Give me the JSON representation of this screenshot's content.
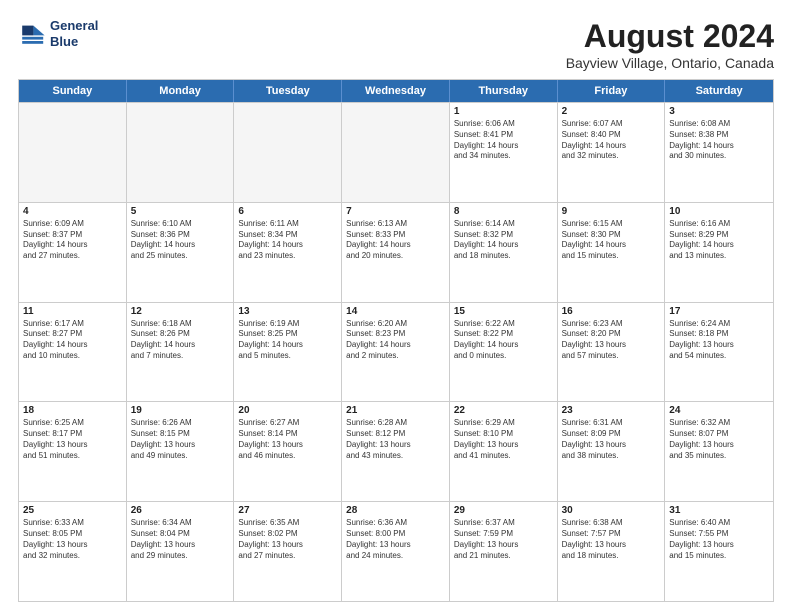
{
  "header": {
    "logo_line1": "General",
    "logo_line2": "Blue",
    "title": "August 2024",
    "subtitle": "Bayview Village, Ontario, Canada"
  },
  "days": [
    "Sunday",
    "Monday",
    "Tuesday",
    "Wednesday",
    "Thursday",
    "Friday",
    "Saturday"
  ],
  "weeks": [
    [
      {
        "day": "",
        "info": "",
        "empty": true
      },
      {
        "day": "",
        "info": "",
        "empty": true
      },
      {
        "day": "",
        "info": "",
        "empty": true
      },
      {
        "day": "",
        "info": "",
        "empty": true
      },
      {
        "day": "1",
        "info": "Sunrise: 6:06 AM\nSunset: 8:41 PM\nDaylight: 14 hours\nand 34 minutes.",
        "empty": false
      },
      {
        "day": "2",
        "info": "Sunrise: 6:07 AM\nSunset: 8:40 PM\nDaylight: 14 hours\nand 32 minutes.",
        "empty": false
      },
      {
        "day": "3",
        "info": "Sunrise: 6:08 AM\nSunset: 8:38 PM\nDaylight: 14 hours\nand 30 minutes.",
        "empty": false
      }
    ],
    [
      {
        "day": "4",
        "info": "Sunrise: 6:09 AM\nSunset: 8:37 PM\nDaylight: 14 hours\nand 27 minutes.",
        "empty": false
      },
      {
        "day": "5",
        "info": "Sunrise: 6:10 AM\nSunset: 8:36 PM\nDaylight: 14 hours\nand 25 minutes.",
        "empty": false
      },
      {
        "day": "6",
        "info": "Sunrise: 6:11 AM\nSunset: 8:34 PM\nDaylight: 14 hours\nand 23 minutes.",
        "empty": false
      },
      {
        "day": "7",
        "info": "Sunrise: 6:13 AM\nSunset: 8:33 PM\nDaylight: 14 hours\nand 20 minutes.",
        "empty": false
      },
      {
        "day": "8",
        "info": "Sunrise: 6:14 AM\nSunset: 8:32 PM\nDaylight: 14 hours\nand 18 minutes.",
        "empty": false
      },
      {
        "day": "9",
        "info": "Sunrise: 6:15 AM\nSunset: 8:30 PM\nDaylight: 14 hours\nand 15 minutes.",
        "empty": false
      },
      {
        "day": "10",
        "info": "Sunrise: 6:16 AM\nSunset: 8:29 PM\nDaylight: 14 hours\nand 13 minutes.",
        "empty": false
      }
    ],
    [
      {
        "day": "11",
        "info": "Sunrise: 6:17 AM\nSunset: 8:27 PM\nDaylight: 14 hours\nand 10 minutes.",
        "empty": false
      },
      {
        "day": "12",
        "info": "Sunrise: 6:18 AM\nSunset: 8:26 PM\nDaylight: 14 hours\nand 7 minutes.",
        "empty": false
      },
      {
        "day": "13",
        "info": "Sunrise: 6:19 AM\nSunset: 8:25 PM\nDaylight: 14 hours\nand 5 minutes.",
        "empty": false
      },
      {
        "day": "14",
        "info": "Sunrise: 6:20 AM\nSunset: 8:23 PM\nDaylight: 14 hours\nand 2 minutes.",
        "empty": false
      },
      {
        "day": "15",
        "info": "Sunrise: 6:22 AM\nSunset: 8:22 PM\nDaylight: 14 hours\nand 0 minutes.",
        "empty": false
      },
      {
        "day": "16",
        "info": "Sunrise: 6:23 AM\nSunset: 8:20 PM\nDaylight: 13 hours\nand 57 minutes.",
        "empty": false
      },
      {
        "day": "17",
        "info": "Sunrise: 6:24 AM\nSunset: 8:18 PM\nDaylight: 13 hours\nand 54 minutes.",
        "empty": false
      }
    ],
    [
      {
        "day": "18",
        "info": "Sunrise: 6:25 AM\nSunset: 8:17 PM\nDaylight: 13 hours\nand 51 minutes.",
        "empty": false
      },
      {
        "day": "19",
        "info": "Sunrise: 6:26 AM\nSunset: 8:15 PM\nDaylight: 13 hours\nand 49 minutes.",
        "empty": false
      },
      {
        "day": "20",
        "info": "Sunrise: 6:27 AM\nSunset: 8:14 PM\nDaylight: 13 hours\nand 46 minutes.",
        "empty": false
      },
      {
        "day": "21",
        "info": "Sunrise: 6:28 AM\nSunset: 8:12 PM\nDaylight: 13 hours\nand 43 minutes.",
        "empty": false
      },
      {
        "day": "22",
        "info": "Sunrise: 6:29 AM\nSunset: 8:10 PM\nDaylight: 13 hours\nand 41 minutes.",
        "empty": false
      },
      {
        "day": "23",
        "info": "Sunrise: 6:31 AM\nSunset: 8:09 PM\nDaylight: 13 hours\nand 38 minutes.",
        "empty": false
      },
      {
        "day": "24",
        "info": "Sunrise: 6:32 AM\nSunset: 8:07 PM\nDaylight: 13 hours\nand 35 minutes.",
        "empty": false
      }
    ],
    [
      {
        "day": "25",
        "info": "Sunrise: 6:33 AM\nSunset: 8:05 PM\nDaylight: 13 hours\nand 32 minutes.",
        "empty": false
      },
      {
        "day": "26",
        "info": "Sunrise: 6:34 AM\nSunset: 8:04 PM\nDaylight: 13 hours\nand 29 minutes.",
        "empty": false
      },
      {
        "day": "27",
        "info": "Sunrise: 6:35 AM\nSunset: 8:02 PM\nDaylight: 13 hours\nand 27 minutes.",
        "empty": false
      },
      {
        "day": "28",
        "info": "Sunrise: 6:36 AM\nSunset: 8:00 PM\nDaylight: 13 hours\nand 24 minutes.",
        "empty": false
      },
      {
        "day": "29",
        "info": "Sunrise: 6:37 AM\nSunset: 7:59 PM\nDaylight: 13 hours\nand 21 minutes.",
        "empty": false
      },
      {
        "day": "30",
        "info": "Sunrise: 6:38 AM\nSunset: 7:57 PM\nDaylight: 13 hours\nand 18 minutes.",
        "empty": false
      },
      {
        "day": "31",
        "info": "Sunrise: 6:40 AM\nSunset: 7:55 PM\nDaylight: 13 hours\nand 15 minutes.",
        "empty": false
      }
    ]
  ]
}
